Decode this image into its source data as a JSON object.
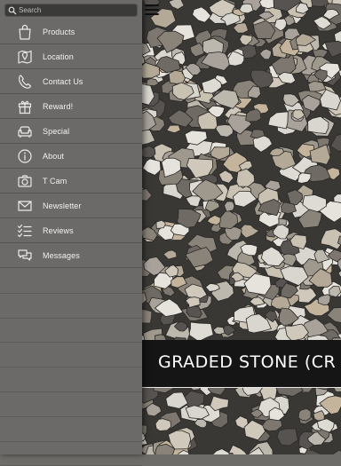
{
  "search": {
    "placeholder": "Search"
  },
  "menu": [
    {
      "label": "Products",
      "icon": "shopping-bag-icon"
    },
    {
      "label": "Location",
      "icon": "map-pin-icon"
    },
    {
      "label": "Contact Us",
      "icon": "phone-icon"
    },
    {
      "label": "Reward!",
      "icon": "gift-icon"
    },
    {
      "label": "Special",
      "icon": "sofa-icon"
    },
    {
      "label": "About",
      "icon": "info-icon"
    },
    {
      "label": "T Cam",
      "icon": "camera-icon"
    },
    {
      "label": "Newsletter",
      "icon": "envelope-icon"
    },
    {
      "label": "Reviews",
      "icon": "checklist-icon"
    },
    {
      "label": "Messages",
      "icon": "speech-bubbles-icon"
    }
  ],
  "banner": {
    "title": "GRADED STONE (CR"
  },
  "colors": {
    "drawer": "#6b6a68",
    "banner": "#151515",
    "banner_text": "#ffffff",
    "label_text": "#f2f2f2"
  }
}
